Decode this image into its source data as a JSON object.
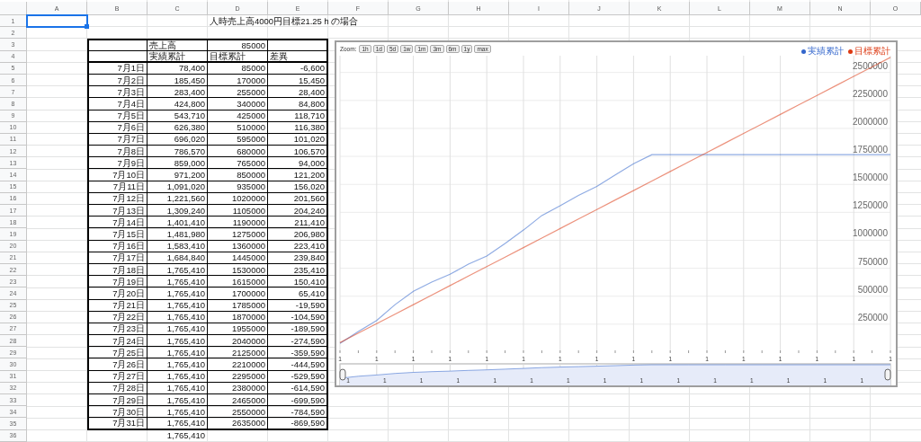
{
  "sheet": {
    "columns": [
      "A",
      "B",
      "C",
      "D",
      "E",
      "F",
      "G",
      "H",
      "I",
      "J",
      "K",
      "L",
      "M",
      "N",
      "O"
    ],
    "rows": [
      {
        "number": "1",
        "kind": "title",
        "d": "人時売上高4000円目標21.25ｈの場合",
        "a_selected": true
      },
      {
        "number": "2",
        "kind": "blank"
      },
      {
        "number": "3",
        "kind": "sales",
        "c": "売上高",
        "d": "85000"
      },
      {
        "number": "4",
        "kind": "labels",
        "c": "実績累計",
        "d": "目標累計",
        "e": "差異"
      },
      {
        "number": "5",
        "kind": "data",
        "b": "7月1日",
        "c": "78,400",
        "d": "85000",
        "e": "-6,600"
      },
      {
        "number": "6",
        "kind": "data",
        "b": "7月2日",
        "c": "185,450",
        "d": "170000",
        "e": "15,450"
      },
      {
        "number": "7",
        "kind": "data",
        "b": "7月3日",
        "c": "283,400",
        "d": "255000",
        "e": "28,400"
      },
      {
        "number": "8",
        "kind": "data",
        "b": "7月4日",
        "c": "424,800",
        "d": "340000",
        "e": "84,800"
      },
      {
        "number": "9",
        "kind": "data",
        "b": "7月5日",
        "c": "543,710",
        "d": "425000",
        "e": "118,710"
      },
      {
        "number": "10",
        "kind": "data",
        "b": "7月6日",
        "c": "626,380",
        "d": "510000",
        "e": "116,380"
      },
      {
        "number": "11",
        "kind": "data",
        "b": "7月7日",
        "c": "696,020",
        "d": "595000",
        "e": "101,020"
      },
      {
        "number": "12",
        "kind": "data",
        "b": "7月8日",
        "c": "786,570",
        "d": "680000",
        "e": "106,570"
      },
      {
        "number": "13",
        "kind": "data",
        "b": "7月9日",
        "c": "859,000",
        "d": "765000",
        "e": "94,000"
      },
      {
        "number": "14",
        "kind": "data",
        "b": "7月10日",
        "c": "971,200",
        "d": "850000",
        "e": "121,200"
      },
      {
        "number": "15",
        "kind": "data",
        "b": "7月11日",
        "c": "1,091,020",
        "d": "935000",
        "e": "156,020"
      },
      {
        "number": "16",
        "kind": "data",
        "b": "7月12日",
        "c": "1,221,560",
        "d": "1020000",
        "e": "201,560"
      },
      {
        "number": "17",
        "kind": "data",
        "b": "7月13日",
        "c": "1,309,240",
        "d": "1105000",
        "e": "204,240"
      },
      {
        "number": "18",
        "kind": "data",
        "b": "7月14日",
        "c": "1,401,410",
        "d": "1190000",
        "e": "211,410"
      },
      {
        "number": "19",
        "kind": "data",
        "b": "7月15日",
        "c": "1,481,980",
        "d": "1275000",
        "e": "206,980"
      },
      {
        "number": "20",
        "kind": "data",
        "b": "7月16日",
        "c": "1,583,410",
        "d": "1360000",
        "e": "223,410"
      },
      {
        "number": "21",
        "kind": "data",
        "b": "7月17日",
        "c": "1,684,840",
        "d": "1445000",
        "e": "239,840"
      },
      {
        "number": "22",
        "kind": "data",
        "b": "7月18日",
        "c": "1,765,410",
        "d": "1530000",
        "e": "235,410"
      },
      {
        "number": "23",
        "kind": "data",
        "b": "7月19日",
        "c": "1,765,410",
        "d": "1615000",
        "e": "150,410"
      },
      {
        "number": "24",
        "kind": "data",
        "b": "7月20日",
        "c": "1,765,410",
        "d": "1700000",
        "e": "65,410"
      },
      {
        "number": "25",
        "kind": "data",
        "b": "7月21日",
        "c": "1,765,410",
        "d": "1785000",
        "e": "-19,590"
      },
      {
        "number": "26",
        "kind": "data",
        "b": "7月22日",
        "c": "1,765,410",
        "d": "1870000",
        "e": "-104,590"
      },
      {
        "number": "27",
        "kind": "data",
        "b": "7月23日",
        "c": "1,765,410",
        "d": "1955000",
        "e": "-189,590"
      },
      {
        "number": "28",
        "kind": "data",
        "b": "7月24日",
        "c": "1,765,410",
        "d": "2040000",
        "e": "-274,590"
      },
      {
        "number": "29",
        "kind": "data",
        "b": "7月25日",
        "c": "1,765,410",
        "d": "2125000",
        "e": "-359,590"
      },
      {
        "number": "30",
        "kind": "data",
        "b": "7月26日",
        "c": "1,765,410",
        "d": "2210000",
        "e": "-444,590"
      },
      {
        "number": "31",
        "kind": "data",
        "b": "7月27日",
        "c": "1,765,410",
        "d": "2295000",
        "e": "-529,590"
      },
      {
        "number": "32",
        "kind": "data",
        "b": "7月28日",
        "c": "1,765,410",
        "d": "2380000",
        "e": "-614,590"
      },
      {
        "number": "33",
        "kind": "data",
        "b": "7月29日",
        "c": "1,765,410",
        "d": "2465000",
        "e": "-699,590"
      },
      {
        "number": "34",
        "kind": "data",
        "b": "7月30日",
        "c": "1,765,410",
        "d": "2550000",
        "e": "-784,590"
      },
      {
        "number": "35",
        "kind": "data",
        "b": "7月31日",
        "c": "1,765,410",
        "d": "2635000",
        "e": "-869,590"
      },
      {
        "number": "36",
        "kind": "total",
        "c": "1,765,410"
      }
    ]
  },
  "chart": {
    "zoom_label": "Zoom:",
    "zoom_buttons": [
      "1h",
      "1d",
      "5d",
      "1w",
      "1m",
      "3m",
      "6m",
      "1y",
      "max"
    ],
    "chart_data": {
      "type": "line",
      "categories": [
        "1",
        null,
        "1",
        null,
        "1",
        null,
        "1",
        null,
        "1",
        null,
        "1",
        null,
        "1",
        null,
        "1",
        null,
        "1",
        null,
        "1",
        null,
        "1",
        null,
        "1",
        null,
        "1",
        null,
        "1",
        null,
        "1",
        null,
        "1"
      ],
      "series": [
        {
          "name": "実績累計",
          "color": "#3366cc",
          "values": [
            78400,
            185450,
            283400,
            424800,
            543710,
            626380,
            696020,
            786570,
            859000,
            971200,
            1091020,
            1221560,
            1309240,
            1401410,
            1481980,
            1583410,
            1684840,
            1765410,
            1765410,
            1765410,
            1765410,
            1765410,
            1765410,
            1765410,
            1765410,
            1765410,
            1765410,
            1765410,
            1765410,
            1765410,
            1765410
          ]
        },
        {
          "name": "目標累計",
          "color": "#dc3912",
          "values": [
            85000,
            170000,
            255000,
            340000,
            425000,
            510000,
            595000,
            680000,
            765000,
            850000,
            935000,
            1020000,
            1105000,
            1190000,
            1275000,
            1360000,
            1445000,
            1530000,
            1615000,
            1700000,
            1785000,
            1870000,
            1955000,
            2040000,
            2125000,
            2210000,
            2295000,
            2380000,
            2465000,
            2550000,
            2635000
          ]
        }
      ],
      "ylim": [
        0,
        2650000
      ],
      "grid": true,
      "legend": "top-right",
      "yticks": [
        250000,
        500000,
        750000,
        1000000,
        1250000,
        1500000,
        1750000,
        2000000,
        2250000,
        2500000
      ]
    },
    "navigator_tick_labels": [
      "1",
      "1",
      "1",
      "1",
      "1",
      "1",
      "1",
      "1",
      "1",
      "1",
      "1",
      "1",
      "1",
      "1",
      "1"
    ]
  }
}
